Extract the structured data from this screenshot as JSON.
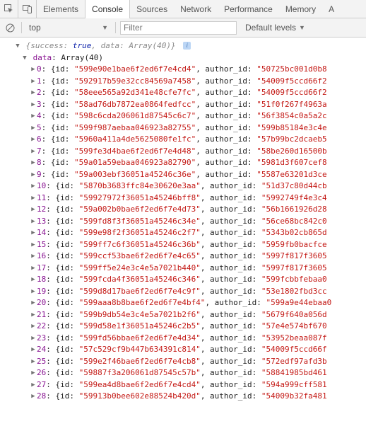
{
  "tabs": [
    "Elements",
    "Console",
    "Sources",
    "Network",
    "Performance",
    "Memory",
    "A"
  ],
  "active_tab": "Console",
  "filterbar": {
    "context": "top",
    "filter_placeholder": "Filter",
    "levels_label": "Default levels"
  },
  "root_preview": {
    "success_key": "success",
    "success_val": "true",
    "data_key": "data",
    "data_val": "Array(40)"
  },
  "expanded_key_label": "data",
  "expanded_type": "Array(40)",
  "rows": [
    {
      "i": 0,
      "id": "599e90e1bae6f2ed6f7e4cd4",
      "author": "50725bc001d0b8"
    },
    {
      "i": 1,
      "id": "592917b59e32cc84569a7458",
      "author": "54009f5ccd66f2"
    },
    {
      "i": 2,
      "id": "58eee565a92d341e48cfe7fc",
      "author": "54009f5ccd66f2"
    },
    {
      "i": 3,
      "id": "58ad76db7872ea0864fedfcc",
      "author": "51f0f267f4963a"
    },
    {
      "i": 4,
      "id": "598c6cda206061d87545c6c7",
      "author": "56f3854c0a5a2c"
    },
    {
      "i": 5,
      "id": "599f987aebaa046923a82755",
      "author": "599b85184e3c4e"
    },
    {
      "i": 6,
      "id": "5960a411a4de5625080fe1fc",
      "author": "57b99bc2dcaeb5"
    },
    {
      "i": 7,
      "id": "599fe3d4bae6f2ed6f7e4d48",
      "author": "58be260d16500b"
    },
    {
      "i": 8,
      "id": "59a01a59ebaa046923a82790",
      "author": "5981d3f607cef8"
    },
    {
      "i": 9,
      "id": "59a003ebf36051a45246c36e",
      "author": "5587e63201d3ce"
    },
    {
      "i": 10,
      "id": "5870b3683ffc84e30620e3aa",
      "author": "51d37c80d44cb"
    },
    {
      "i": 11,
      "id": "59927972f36051a45246bff8",
      "author": "5992749f4e3c4"
    },
    {
      "i": 12,
      "id": "59a002b0bae6f2ed6f7e4d73",
      "author": "56b1661926d28"
    },
    {
      "i": 13,
      "id": "599fd8f3f36051a45246c34e",
      "author": "56ce68bc842c0"
    },
    {
      "i": 14,
      "id": "599e98f2f36051a45246c2f7",
      "author": "5343b02cb865d"
    },
    {
      "i": 15,
      "id": "599ff7c6f36051a45246c36b",
      "author": "5959fb0bacfce"
    },
    {
      "i": 16,
      "id": "599ccf53bae6f2ed6f7e4c65",
      "author": "5997f817f3605"
    },
    {
      "i": 17,
      "id": "599ff5e24e3c4e5a7021b440",
      "author": "5997f817f3605"
    },
    {
      "i": 18,
      "id": "599fcda4f36051a45246c346",
      "author": "599fcbbfebaa0"
    },
    {
      "i": 19,
      "id": "599d8d17bae6f2ed6f7e4c9f",
      "author": "53e1802fbd3cc"
    },
    {
      "i": 20,
      "id": "599aaa8b8bae6f2ed6f7e4bf4",
      "author": "599a9e44ebaa0"
    },
    {
      "i": 21,
      "id": "599b9db54e3c4e5a7021b2f6",
      "author": "5679f640a056d"
    },
    {
      "i": 22,
      "id": "599d58e1f36051a45246c2b5",
      "author": "57e4e574bf670"
    },
    {
      "i": 23,
      "id": "599fd56bbae6f2ed6f7e4d34",
      "author": "53952beaa087f"
    },
    {
      "i": 24,
      "id": "57c529cf9b447b634391c814",
      "author": "54009f5ccd66f"
    },
    {
      "i": 25,
      "id": "599e2f46bae6f2ed6f7e4cb8",
      "author": "572edf97afd3b"
    },
    {
      "i": 26,
      "id": "59887f3a206061d87545c57b",
      "author": "58841985bd461"
    },
    {
      "i": 27,
      "id": "599ea4d8bae6f2ed6f7e4cd4",
      "author": "594a999cff581"
    },
    {
      "i": 28,
      "id": "59913b0bee602e88524b420d",
      "author": "54009b32fa481"
    }
  ],
  "labels": {
    "id_key": "id",
    "author_key": "author_id"
  }
}
